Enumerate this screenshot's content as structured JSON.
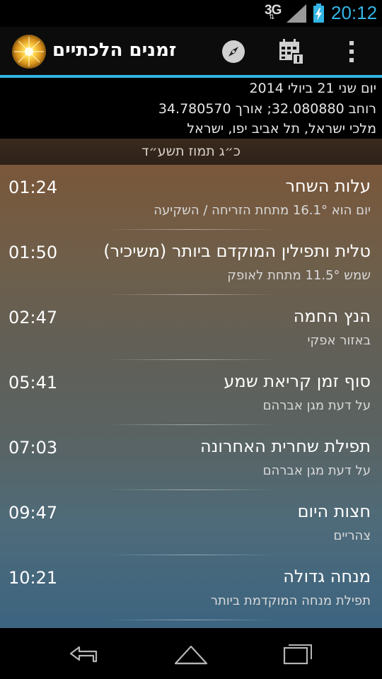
{
  "status_bar": {
    "network": "3G",
    "time": "20:12",
    "colors": {
      "accent": "#33b5e5"
    }
  },
  "action_bar": {
    "title": "זמנים הלכתיים",
    "icons": [
      "sun-logo-icon",
      "compass-icon",
      "calendar-icon",
      "overflow-menu-icon"
    ]
  },
  "info": {
    "date": "יום שני 21 ביולי 2014",
    "coordinates": "רוחב 32.080880; אורך 34.780570",
    "address": "מלכי ישראל, תל אביב יפו, ישראל"
  },
  "hebrew_date": "כ״ג תמוז תשע״ד",
  "zmanim": [
    {
      "name": "עלות השחר",
      "desc": "יום הוא 16.1° מתחת הזריחה / השקיעה",
      "time": "01:24"
    },
    {
      "name": "טלית ותפילין המוקדם ביותר (משיכיר)",
      "desc": "שמש 11.5° מתחת לאופק",
      "time": "01:50"
    },
    {
      "name": "הנץ החמה",
      "desc": "באזור אפקי",
      "time": "02:47"
    },
    {
      "name": "סוף זמן קריאת שמע",
      "desc": "על דעת מגן אברהם",
      "time": "05:41"
    },
    {
      "name": "תפילת שחרית האחרונה",
      "desc": "על דעת מגן אברהם",
      "time": "07:03"
    },
    {
      "name": "חצות היום",
      "desc": "צהריים",
      "time": "09:47"
    },
    {
      "name": "מנחה גדולה",
      "desc": "תפילת מנחה המוקדמת ביותר",
      "time": "10:21"
    }
  ],
  "nav_bar": {
    "icons": [
      "back-icon",
      "home-icon",
      "recent-apps-icon"
    ]
  }
}
